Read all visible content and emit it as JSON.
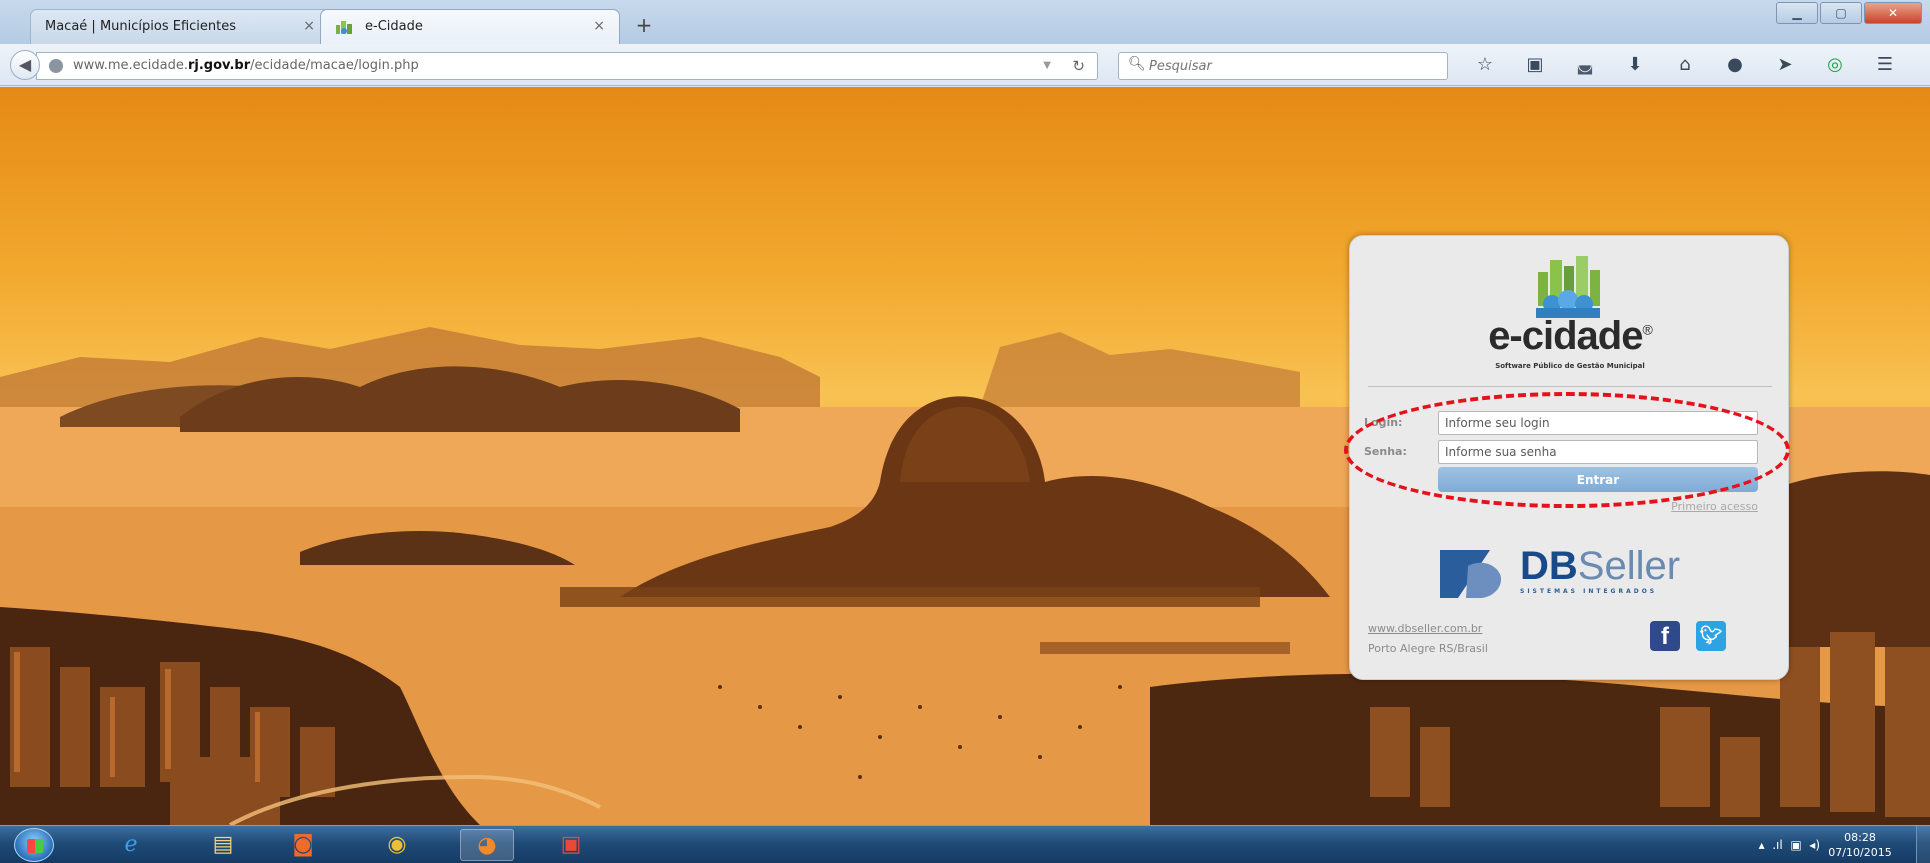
{
  "browser": {
    "tabs": [
      {
        "label": "Macaé | Municípios Eficientes",
        "close": "×"
      },
      {
        "label": "e-Cidade",
        "close": "×"
      }
    ],
    "new_tab": "+",
    "url_prefix": "www.me.ecidade.",
    "url_domain": "rj.gov.br",
    "url_path": "/ecidade/macae/login.php",
    "search_placeholder": "Pesquisar",
    "toolbar_icons": [
      "star-icon",
      "clipboard-icon",
      "pocket-icon",
      "download-icon",
      "home-icon",
      "chat-icon",
      "send-icon",
      "sync-icon",
      "menu-icon"
    ]
  },
  "login": {
    "brand": "e-cidade",
    "brand_mark": "®",
    "brand_subtitle": "Software Público de Gestão Municipal",
    "login_label": "Login:",
    "login_placeholder": "Informe seu login",
    "password_label": "Senha:",
    "password_placeholder": "Informe sua senha",
    "submit_label": "Entrar",
    "first_access": "Primeiro acesso"
  },
  "footer": {
    "company_bold": "DB",
    "company_light": "Seller",
    "company_tagline": "SISTEMAS INTEGRADOS",
    "website": "www.dbseller.com.br",
    "location": "Porto Alegre RS/Brasil"
  },
  "taskbar": {
    "time": "08:28",
    "date": "07/10/2015"
  },
  "colors": {
    "highlight": "#e5121b",
    "button": "#8fb7dd",
    "facebook": "#2f4a8a",
    "twitter": "#2ca3e2"
  }
}
